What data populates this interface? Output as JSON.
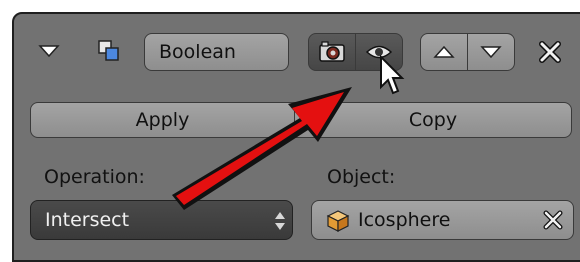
{
  "header": {
    "modifier_name": "Boolean",
    "collapse_icon": "triangle-down-icon",
    "modifier_type_icon": "boolean-modifier-icon",
    "render_toggle_icon": "camera-icon",
    "viewport_toggle_icon": "eye-icon",
    "move_up_icon": "triangle-up-icon",
    "move_down_icon": "triangle-down-icon",
    "remove_icon": "close-icon"
  },
  "actions": {
    "apply_label": "Apply",
    "copy_label": "Copy"
  },
  "settings": {
    "operation_label": "Operation:",
    "operation_value": "Intersect",
    "object_label": "Object:",
    "object_value": "Icosphere",
    "object_icon": "mesh-cube-icon"
  },
  "colors": {
    "panel_bg": "#727272",
    "annotation_arrow": "#e41010"
  }
}
